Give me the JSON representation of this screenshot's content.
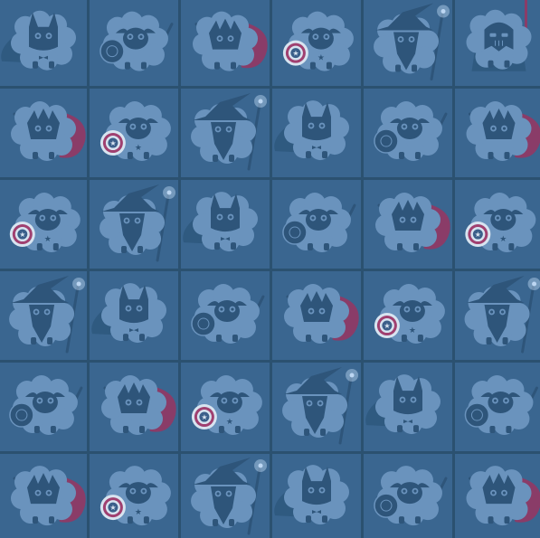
{
  "board": {
    "rows": 6,
    "cols": 6,
    "colors": {
      "background": "#2b5170",
      "tile": "#3a6690",
      "wool": "#6a93bd",
      "face": "#2e557a",
      "cape": "#8a3c68",
      "shield_red": "#a04070",
      "shield_white": "#d8e4f0",
      "staff": "#2e557a",
      "sparkle": "#bcd6f2"
    },
    "tiles": [
      [
        "batman-sheep",
        "captain-sheep",
        "super-sheep",
        "captain-america-sheep",
        "wizard-sheep",
        "vader-sheep"
      ],
      [
        "super-sheep",
        "captain-america-sheep",
        "wizard-sheep",
        "batman-sheep",
        "captain-sheep",
        "super-sheep"
      ],
      [
        "captain-america-sheep",
        "wizard-sheep",
        "batman-sheep",
        "captain-sheep",
        "super-sheep",
        "captain-america-sheep"
      ],
      [
        "wizard-sheep",
        "batman-sheep",
        "captain-sheep",
        "super-sheep",
        "captain-america-sheep",
        "wizard-sheep"
      ],
      [
        "captain-sheep",
        "super-sheep",
        "captain-america-sheep",
        "wizard-sheep",
        "batman-sheep",
        "captain-sheep"
      ],
      [
        "super-sheep",
        "captain-america-sheep",
        "wizard-sheep",
        "batman-sheep",
        "captain-sheep",
        "super-sheep"
      ]
    ]
  }
}
